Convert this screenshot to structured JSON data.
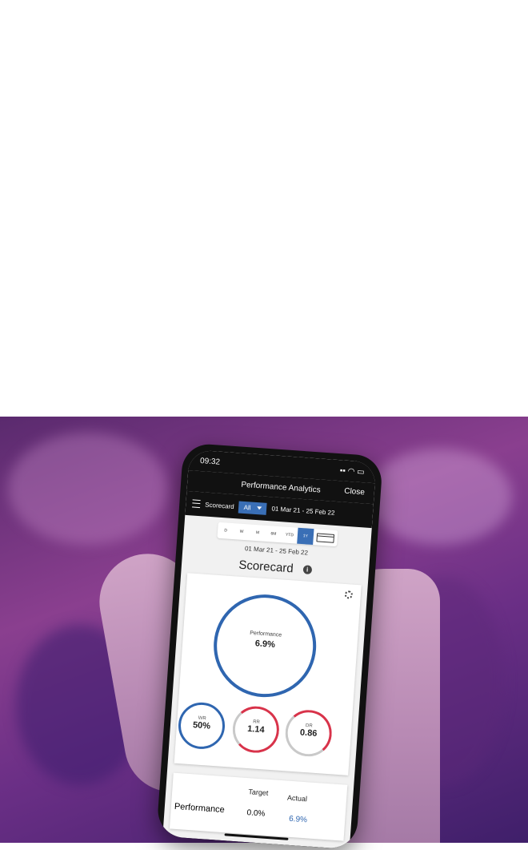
{
  "status": {
    "time": "09:32"
  },
  "header": {
    "title": "Performance Analytics",
    "close_label": "Close"
  },
  "toolbar": {
    "section_label": "Scorecard",
    "dropdown_value": "All",
    "date_range": "01 Mar 21 - 25 Feb 22"
  },
  "periods": {
    "items": [
      "D",
      "W",
      "M",
      "6M",
      "YTD",
      "1Y"
    ],
    "active": "1Y"
  },
  "subtitle_date": "01 Mar 21 - 25 Feb 22",
  "scorecard": {
    "title": "Scorecard",
    "main": {
      "label": "Performance",
      "value": "6.9%"
    },
    "metrics": [
      {
        "label": "WR",
        "value": "50%",
        "color": "#2f66b0",
        "fill": 1.0
      },
      {
        "label": "RR",
        "value": "1.14",
        "color": "#d8334a",
        "fill": 0.55
      },
      {
        "label": "DR",
        "value": "0.86",
        "color": "#d8334a",
        "fill": 0.45
      }
    ]
  },
  "performance_table": {
    "headers": [
      "Target",
      "Actual"
    ],
    "row": {
      "label": "Performance",
      "target": "0.0%",
      "actual": "6.9%",
      "actual_color": "#2f66b0"
    }
  }
}
